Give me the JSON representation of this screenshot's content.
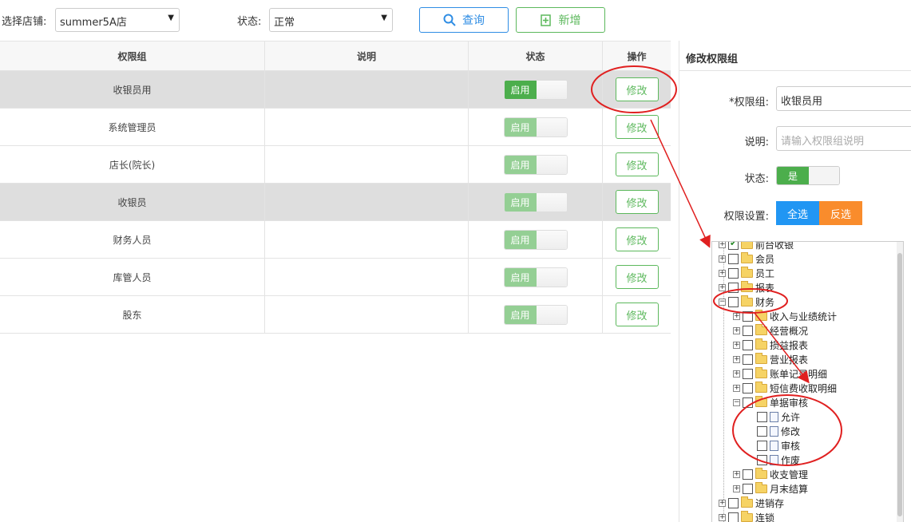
{
  "filters": {
    "store_label": "选择店铺:",
    "store_value": "summer5A店",
    "status_label": "状态:",
    "status_value": "正常",
    "query_label": "查询",
    "add_label": "新增"
  },
  "table": {
    "headers": [
      "权限组",
      "说明",
      "状态",
      "操作"
    ],
    "rows": [
      {
        "name": "收银员用",
        "desc": "",
        "status": "启用",
        "action": "修改"
      },
      {
        "name": "系统管理员",
        "desc": "",
        "status": "启用",
        "action": "修改"
      },
      {
        "name": "店长(院长)",
        "desc": "",
        "status": "启用",
        "action": "修改"
      },
      {
        "name": "收银员",
        "desc": "",
        "status": "启用",
        "action": "修改"
      },
      {
        "name": "财务人员",
        "desc": "",
        "status": "启用",
        "action": "修改"
      },
      {
        "name": "库管人员",
        "desc": "",
        "status": "启用",
        "action": "修改"
      },
      {
        "name": "股东",
        "desc": "",
        "status": "启用",
        "action": "修改"
      }
    ]
  },
  "panel": {
    "title": "修改权限组",
    "group_label": "*权限组:",
    "group_value": "收银员用",
    "desc_label": "说明:",
    "desc_placeholder": "请输入权限组说明",
    "status_label": "状态:",
    "status_value": "是",
    "perm_label": "权限设置:",
    "select_all": "全选",
    "invert": "反选"
  },
  "tree": {
    "nodes": [
      {
        "label": "前台收银",
        "level": 0,
        "exp": "+",
        "checked": true
      },
      {
        "label": "会员",
        "level": 0,
        "exp": "+"
      },
      {
        "label": "员工",
        "level": 0,
        "exp": "+"
      },
      {
        "label": "报表",
        "level": 0,
        "exp": "+"
      },
      {
        "label": "财务",
        "level": 0,
        "exp": "-"
      },
      {
        "label": "收入与业绩统计",
        "level": 1,
        "exp": "+"
      },
      {
        "label": "经营概况",
        "level": 1,
        "exp": "+"
      },
      {
        "label": "损益报表",
        "level": 1,
        "exp": "+"
      },
      {
        "label": "营业报表",
        "level": 1,
        "exp": "+"
      },
      {
        "label": "账单记录明细",
        "level": 1,
        "exp": "+"
      },
      {
        "label": "短信费收取明细",
        "level": 1,
        "exp": "+"
      },
      {
        "label": "单据审核",
        "level": 1,
        "exp": "-"
      },
      {
        "label": "允许",
        "level": 2,
        "leaf": true
      },
      {
        "label": "修改",
        "level": 2,
        "leaf": true
      },
      {
        "label": "审核",
        "level": 2,
        "leaf": true
      },
      {
        "label": "作废",
        "level": 2,
        "leaf": true
      },
      {
        "label": "收支管理",
        "level": 1,
        "exp": "+"
      },
      {
        "label": "月末结算",
        "level": 1,
        "exp": "+"
      },
      {
        "label": "进销存",
        "level": 0,
        "exp": "+"
      },
      {
        "label": "连锁",
        "level": 0,
        "exp": "+"
      }
    ]
  },
  "colors": {
    "accent_blue": "#2f8de4",
    "accent_green": "#5cb85c",
    "select_all_bg": "#2196f3",
    "invert_bg": "#f98c2c",
    "annotation_red": "#e02020"
  }
}
